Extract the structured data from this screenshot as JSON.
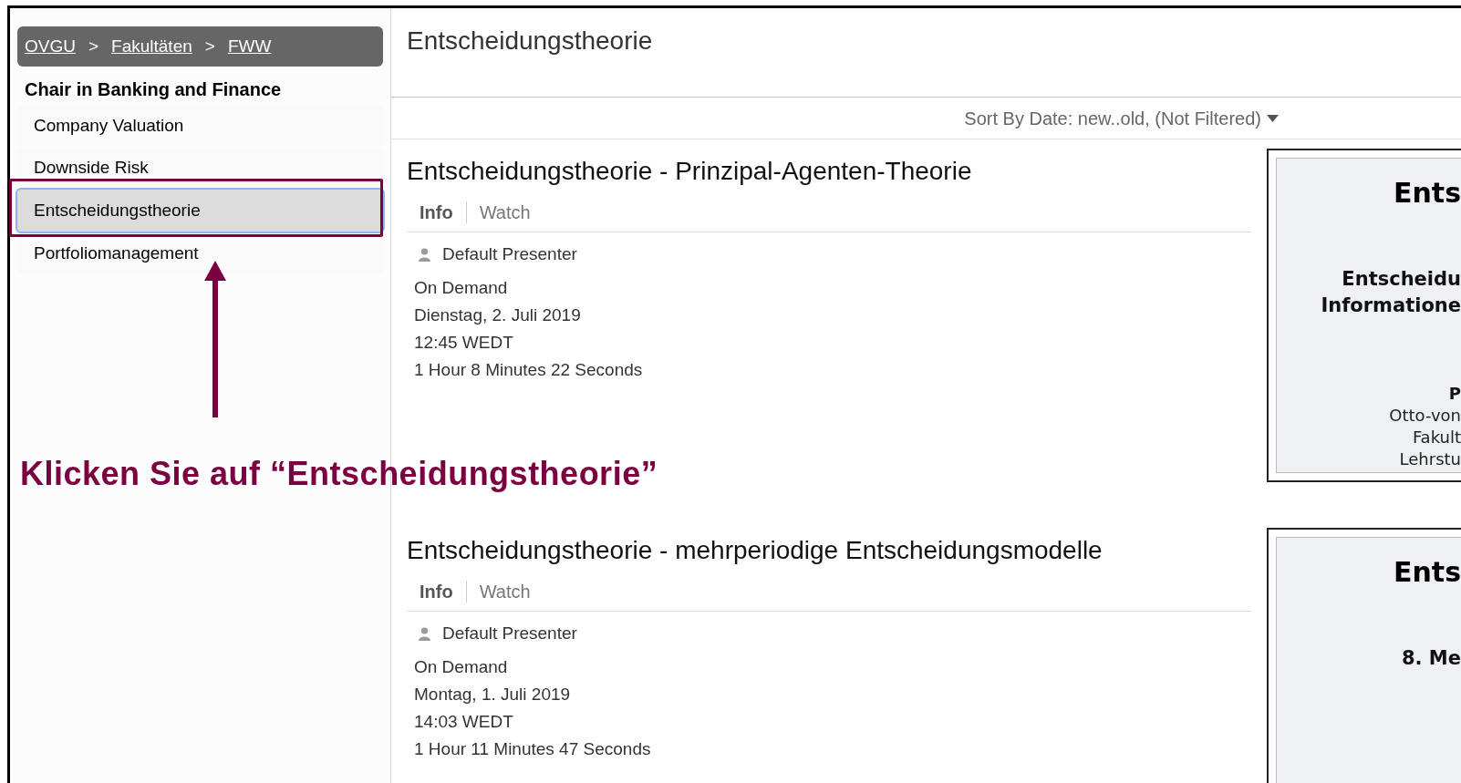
{
  "breadcrumb": [
    {
      "kind": "link",
      "text": "OVGU"
    },
    {
      "kind": "separator",
      "text": ">"
    },
    {
      "kind": "link",
      "text": "Fakultäten"
    },
    {
      "kind": "separator",
      "text": ">"
    },
    {
      "kind": "link",
      "text": "FWW"
    }
  ],
  "sidebar": {
    "heading": "Chair in Banking and Finance",
    "items": [
      {
        "label": "Company Valuation",
        "selected": false
      },
      {
        "label": "Downside Risk",
        "selected": false
      },
      {
        "label": "Entscheidungstheorie",
        "selected": true
      },
      {
        "label": "Portfoliomanagement",
        "selected": false
      }
    ]
  },
  "page_title": "Entscheidungstheorie",
  "sort_label": "Sort By Date: new..old, (Not Filtered)",
  "recordings": [
    {
      "title": "Entscheidungstheorie - Prinzipal-Agenten-Theorie",
      "tabs": [
        {
          "label": "Info",
          "selected": true
        },
        {
          "label": "Watch",
          "selected": false
        }
      ],
      "presenter": "Default Presenter",
      "details": [
        "On Demand",
        "Dienstag, 2. Juli 2019",
        "12:45 WEDT",
        "1 Hour 8 Minutes 22 Seconds"
      ],
      "slide_lines": [
        {
          "kind": "title",
          "text": "Ents"
        },
        {
          "kind": "subtitle",
          "text": "Entscheidu"
        },
        {
          "kind": "subtitle",
          "text": "Informatione"
        },
        {
          "kind": "name",
          "text": "P"
        },
        {
          "kind": "body",
          "text": "Otto-von"
        },
        {
          "kind": "body",
          "text": "Fakult"
        },
        {
          "kind": "body",
          "text": "Lehrstu"
        }
      ]
    },
    {
      "title": "Entscheidungstheorie - mehrperiodige Entscheidungsmodelle",
      "tabs": [
        {
          "label": "Info",
          "selected": true
        },
        {
          "label": "Watch",
          "selected": false
        }
      ],
      "presenter": "Default Presenter",
      "details": [
        "On Demand",
        "Montag, 1. Juli 2019",
        "14:03 WEDT",
        "1 Hour 11 Minutes 47 Seconds"
      ],
      "slide_lines": [
        {
          "kind": "title",
          "text": "Ents"
        },
        {
          "kind": "subtitle",
          "text": "8. Me"
        }
      ]
    }
  ],
  "annotation": {
    "text": "Klicken Sie auf “Entscheidungstheorie”"
  }
}
